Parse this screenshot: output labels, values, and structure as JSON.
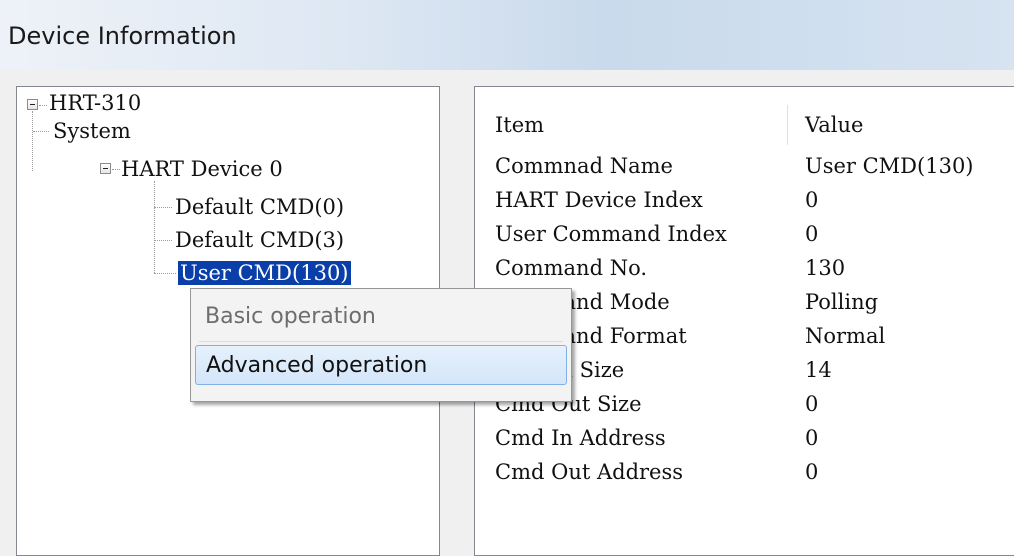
{
  "window": {
    "title": "Device Information"
  },
  "tree": {
    "root": "HRT-310",
    "system": "System",
    "device": "HART Device 0",
    "children": [
      "Default CMD(0)",
      "Default CMD(3)",
      "User CMD(130)"
    ]
  },
  "list": {
    "headers": {
      "item": "Item",
      "value": "Value"
    },
    "rows": [
      {
        "item": "Commnad Name",
        "value": "User CMD(130)"
      },
      {
        "item": "HART Device Index",
        "value": "0"
      },
      {
        "item": "User Command Index",
        "value": "0"
      },
      {
        "item": "Command No.",
        "value": "130"
      },
      {
        "item": "Command Mode",
        "value": "Polling"
      },
      {
        "item": "Command Format",
        "value": "Normal"
      },
      {
        "item": "Cmd In Size",
        "value": "14"
      },
      {
        "item": "Cmd Out Size",
        "value": "0"
      },
      {
        "item": "Cmd In Address",
        "value": "0"
      },
      {
        "item": "Cmd Out Address",
        "value": "0"
      }
    ]
  },
  "context_menu": {
    "items": [
      {
        "label": "Basic operation"
      },
      {
        "label": "Advanced operation"
      }
    ]
  }
}
